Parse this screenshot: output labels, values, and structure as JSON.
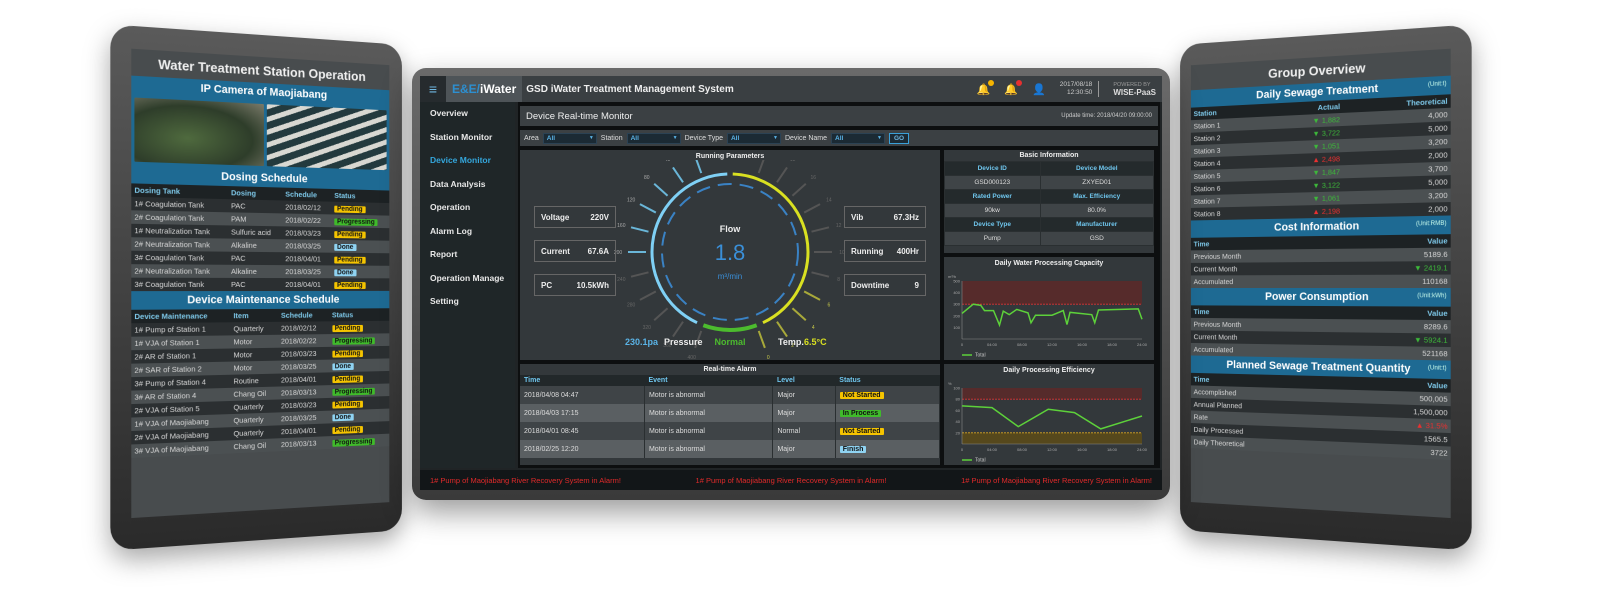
{
  "left_panel": {
    "title": "Water Treatment Station Operation",
    "camera_title": "IP Camera of Maojiabang",
    "dosing": {
      "title": "Dosing Schedule",
      "columns": [
        "Dosing Tank",
        "Dosing",
        "Schedule",
        "Status"
      ],
      "rows": [
        [
          "1# Coagulation Tank",
          "PAC",
          "2018/02/12",
          "Pending"
        ],
        [
          "2# Coagulation Tank",
          "PAM",
          "2018/02/22",
          "Progressing"
        ],
        [
          "1# Neutralization Tank",
          "Sulfuric acid",
          "2018/03/23",
          "Pending"
        ],
        [
          "2# Neutralization Tank",
          "Alkaline",
          "2018/03/25",
          "Done"
        ],
        [
          "3# Coagulation Tank",
          "PAC",
          "2018/04/01",
          "Pending"
        ],
        [
          "2# Neutralization Tank",
          "Alkaline",
          "2018/03/25",
          "Done"
        ],
        [
          "3# Coagulation Tank",
          "PAC",
          "2018/04/01",
          "Pending"
        ]
      ]
    },
    "maintenance": {
      "title": "Device Maintenance Schedule",
      "columns": [
        "Device Maintenance",
        "Item",
        "Schedule",
        "Status"
      ],
      "rows": [
        [
          "1# Pump of Station 1",
          "Quarterly",
          "2018/02/12",
          "Pending"
        ],
        [
          "1# VJA of Station 1",
          "Motor",
          "2018/02/22",
          "Progressing"
        ],
        [
          "2# AR of Station 1",
          "Motor",
          "2018/03/23",
          "Pending"
        ],
        [
          "2# SAR of Station 2",
          "Motor",
          "2018/03/25",
          "Done"
        ],
        [
          "3# Pump of Station 4",
          "Routine",
          "2018/04/01",
          "Pending"
        ],
        [
          "3# AR of Station 4",
          "Chang Oil",
          "2018/03/13",
          "Progressing"
        ],
        [
          "2# VJA of Station 5",
          "Quarterly",
          "2018/03/23",
          "Pending"
        ],
        [
          "1# VJA of Maojiabang",
          "Quarterly",
          "2018/03/25",
          "Done"
        ],
        [
          "2# VJA of Maojiabang",
          "Quarterly",
          "2018/04/01",
          "Pending"
        ],
        [
          "3# VJA of Maojiabang",
          "Chang Oil",
          "2018/03/13",
          "Progressing"
        ]
      ]
    }
  },
  "main": {
    "logo_a": "E&E/",
    "logo_b": "iWater",
    "system_title": "GSD iWater Treatment Management System",
    "date": "2017/08/18",
    "time": "12:30:50",
    "powered_by": "POWERED BY",
    "powered_brand": "WISE-PaaS",
    "notifications": [
      {
        "icon": "bell-icon",
        "color": "#f5b400"
      },
      {
        "icon": "bell-icon",
        "color": "#e53030"
      }
    ],
    "nav": [
      "Overview",
      "Station Monitor",
      "Device Monitor",
      "Data Analysis",
      "Operation",
      "Alarm Log",
      "Report",
      "Operation Manage",
      "Setting"
    ],
    "active_nav": "Device Monitor",
    "page_title": "Device Real-time Monitor",
    "update_time": "Update time: 2018/04/20 09:00:00",
    "filters": [
      {
        "label": "Area",
        "value": "All"
      },
      {
        "label": "Station",
        "value": "All"
      },
      {
        "label": "Device Type",
        "value": "All"
      },
      {
        "label": "Device Name",
        "value": "All"
      }
    ],
    "go_label": "GO",
    "running": {
      "title": "Running Parameters",
      "left": [
        {
          "label": "Voltage",
          "value": "220V"
        },
        {
          "label": "Current",
          "value": "67.6A"
        },
        {
          "label": "PC",
          "value": "10.5kWh"
        }
      ],
      "right": [
        {
          "label": "Vib",
          "value": "67.3Hz"
        },
        {
          "label": "Running",
          "value": "400Hr"
        },
        {
          "label": "Downtime",
          "value": "9"
        }
      ],
      "flow_label": "Flow",
      "flow_value": "1.8",
      "flow_unit": "m³/min",
      "pressure_value": "230.1pa",
      "pressure_label": "Pressure",
      "status": "Normal",
      "temp_label": "Temp.",
      "temp_value": "6.5°C",
      "pressure_scale": [
        "0",
        "40",
        "80",
        "120",
        "160",
        "200",
        "240",
        "280",
        "320",
        "360",
        "400"
      ],
      "temp_scale": [
        "0",
        "2",
        "4",
        "6",
        "8",
        "10",
        "12",
        "14",
        "16",
        "18",
        "20"
      ],
      "pressure_level": 0.55,
      "temp_level": 0.33
    },
    "basic_info": {
      "title": "Basic Information",
      "rows": [
        {
          "h": [
            "Device ID",
            "Device Model"
          ],
          "v": [
            "GSD000123",
            "ZXYED01"
          ]
        },
        {
          "h": [
            "Rated Power",
            "Max. Efficiency"
          ],
          "v": [
            "90kw",
            "80.0%"
          ]
        },
        {
          "h": [
            "Device Type",
            "Manufacturer"
          ],
          "v": [
            "Pump",
            "GSD"
          ]
        }
      ]
    },
    "alarm": {
      "title": "Real-time Alarm",
      "columns": [
        "Time",
        "Event",
        "Level",
        "Status"
      ],
      "rows": [
        [
          "2018/04/08 04:47",
          "Motor is abnormal",
          "Major",
          "Not Started"
        ],
        [
          "2018/04/03 17:15",
          "Motor is abnormal",
          "Major",
          "In Process"
        ],
        [
          "2018/04/01 08:45",
          "Motor is abnormal",
          "Normal",
          "Not Started"
        ],
        [
          "2018/02/25 12:20",
          "Motor is abnormal",
          "Major",
          "Finish"
        ]
      ]
    },
    "ticker": [
      "1# Pump of Maojiabang River Recovery System in Alarm!",
      "1# Pump of Maojiabang River Recovery System in Alarm!",
      "1# Pump of Maojiabang River Recovery System in Alarm!"
    ]
  },
  "chart_data": [
    {
      "type": "line",
      "title": "Daily Water Processing Capacity",
      "ylabel": "m³/h",
      "ylim": [
        0,
        500
      ],
      "yticks": [
        "100",
        "200",
        "300",
        "400",
        "500"
      ],
      "xticks": [
        "0",
        "04:00",
        "08:00",
        "12:00",
        "16:00",
        "18:00",
        "24:00"
      ],
      "xlim": [
        0,
        24
      ],
      "alarm_band": [
        300,
        500
      ],
      "legend": "Total",
      "series": [
        {
          "name": "Total",
          "x": [
            0,
            1.5,
            2.5,
            3,
            4.2,
            5,
            5.5,
            6.3,
            7.3,
            8.8,
            9.2,
            9.8,
            12,
            13.5,
            14,
            14.4,
            17.3,
            17.7,
            18.2,
            23.5,
            24
          ],
          "values": [
            220,
            300,
            290,
            245,
            245,
            120,
            240,
            210,
            255,
            225,
            140,
            205,
            205,
            245,
            125,
            230,
            210,
            140,
            250,
            260,
            170
          ]
        }
      ]
    },
    {
      "type": "line",
      "title": "Daily Processing Efficiency",
      "ylabel": "%",
      "ylim": [
        0,
        100
      ],
      "yticks": [
        "20",
        "40",
        "60",
        "80",
        "100"
      ],
      "xticks": [
        "0",
        "04:00",
        "08:00",
        "12:00",
        "16:00",
        "18:00",
        "24:00"
      ],
      "xlim": [
        0,
        24
      ],
      "alarm_band": [
        80,
        100
      ],
      "low_band": [
        0,
        20
      ],
      "legend": "Total",
      "series": [
        {
          "name": "Total",
          "x": [
            0,
            4,
            7.5,
            11.5,
            15,
            18.5,
            24
          ],
          "values": [
            68,
            65,
            31,
            62,
            56,
            27,
            50
          ]
        }
      ]
    }
  ],
  "right_panel": {
    "title": "Group Overview",
    "sewage": {
      "title": "Daily Sewage Treatment",
      "unit": "(Unit:t)",
      "columns": [
        "Station",
        "Actual",
        "Theoretical"
      ],
      "rows": [
        [
          "Station 1",
          "down",
          "1,882",
          "4,000"
        ],
        [
          "Station 2",
          "down",
          "3,722",
          "5,000"
        ],
        [
          "Station 3",
          "down",
          "1,051",
          "3,200"
        ],
        [
          "Station 4",
          "up",
          "2,498",
          "2,000"
        ],
        [
          "Station 5",
          "down",
          "1,847",
          "3,700"
        ],
        [
          "Station 6",
          "down",
          "3,122",
          "5,000"
        ],
        [
          "Station 7",
          "down",
          "1,061",
          "3,200"
        ],
        [
          "Station 8",
          "up",
          "2,198",
          "2,000"
        ]
      ]
    },
    "cost": {
      "title": "Cost Information",
      "unit": "(Unit:RMB)",
      "columns": [
        "Time",
        "Value"
      ],
      "rows": [
        [
          "Previous Month",
          "",
          "5189.6"
        ],
        [
          "Current Month",
          "down",
          "2419.1"
        ],
        [
          "Accumulated",
          "",
          "110168"
        ]
      ]
    },
    "power": {
      "title": "Power Consumption",
      "unit": "(Unit:kWh)",
      "columns": [
        "Time",
        "Value"
      ],
      "rows": [
        [
          "Previous Month",
          "",
          "8289.6"
        ],
        [
          "Current Month",
          "down",
          "5924.1"
        ],
        [
          "Accumulated",
          "",
          "521168"
        ]
      ]
    },
    "planned": {
      "title": "Planned Sewage Treatment Quantity",
      "unit": "(Unit:t)",
      "columns": [
        "Time",
        "Value"
      ],
      "rows": [
        [
          "Accomplished",
          "",
          "500,005"
        ],
        [
          "Annual Planned",
          "",
          "1,500,000"
        ],
        [
          "Rate",
          "up",
          "31.5%"
        ],
        [
          "Daily Processed",
          "",
          "1565.5"
        ],
        [
          "Daily Theoretical",
          "",
          "3722"
        ]
      ]
    }
  }
}
